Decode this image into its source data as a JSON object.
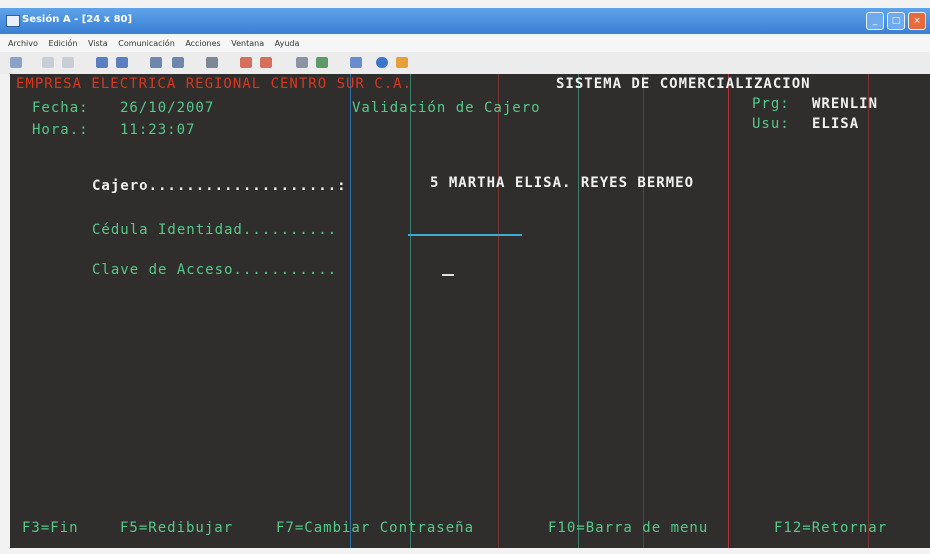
{
  "window": {
    "title": "Sesión A - [24 x 80]",
    "controls": [
      "_",
      "□",
      "×"
    ]
  },
  "menu": [
    "Archivo",
    "Edición",
    "Vista",
    "Comunicación",
    "Acciones",
    "Ventana",
    "Ayuda"
  ],
  "header": {
    "company": "EMPRESA ELECTRICA REGIONAL CENTRO SUR C.A.",
    "system": "SISTEMA DE COMERCIALIZACION",
    "date_label": "Fecha:",
    "date_value": "26/10/2007",
    "time_label": "Hora.:",
    "time_value": "11:23:07",
    "screen_title": "Validación de Cajero",
    "program_label": "Prg:",
    "program_value": "WRENLIN",
    "user_label": "Usu:",
    "user_value": "ELISA"
  },
  "form": {
    "cashier_label": "Cajero....................:",
    "cashier_value": "5 MARTHA ELISA. REYES BERMEO",
    "id_label": "Cédula Identidad..........",
    "access_label": "Clave de Acceso...........",
    "access_value": "_"
  },
  "function_keys": [
    "F3=Fin",
    "F5=Redibujar",
    "F7=Cambiar Contraseña",
    "F10=Barra de menu",
    "F12=Retornar"
  ],
  "colors": {
    "terminal_bg": "#302e2c",
    "red": "#d9361f",
    "green": "#55c98a",
    "white": "#f1f1f1",
    "cyan": "#3fa9cf"
  }
}
